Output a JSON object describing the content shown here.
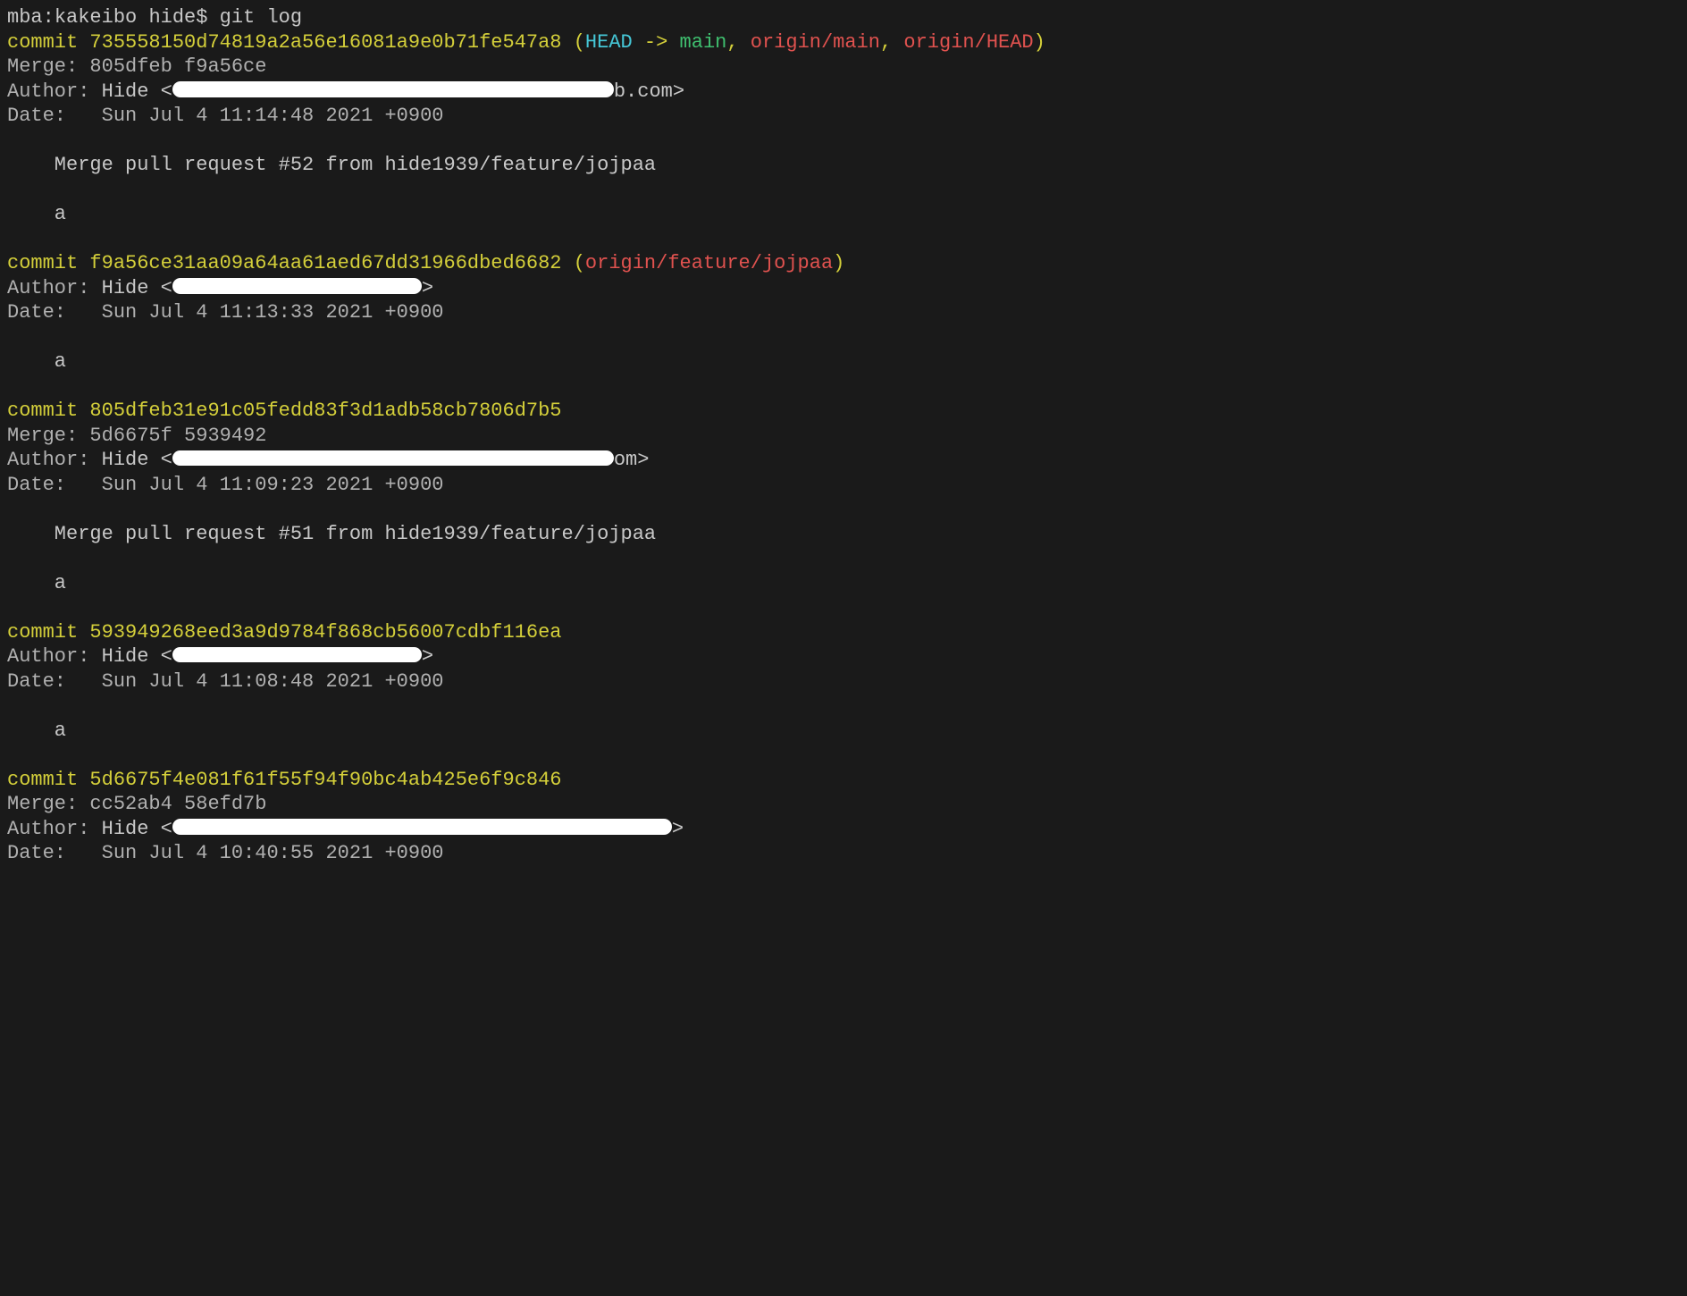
{
  "prompt": {
    "host": "mba",
    "path": "kakeibo",
    "user": "hide",
    "symbol": "$",
    "command": "git log"
  },
  "commits": [
    {
      "label": "commit",
      "hash": "735558150d74819a2a56e16081a9e0b71fe547a8",
      "refs_open": " (",
      "head": "HEAD",
      "arrow": " -> ",
      "main": "main",
      "sep1": ", ",
      "remote1": "origin/main",
      "sep2": ", ",
      "remote2": "origin/HEAD",
      "refs_close": ")",
      "merge_label": "Merge: ",
      "merge_value": "805dfeb f9a56ce",
      "author_label": "Author: ",
      "author_name": "Hide ",
      "author_open": "<",
      "author_tail": "b.com>",
      "date_label": "Date:   ",
      "date_value": "Sun Jul 4 11:14:48 2021 +0900",
      "body1": "    Merge pull request #52 from hide1939/feature/jojpaa",
      "body2": "    a"
    },
    {
      "label": "commit",
      "hash": "f9a56ce31aa09a64aa61aed67dd31966dbed6682",
      "refs_open": " (",
      "remote1": "origin/feature/jojpaa",
      "refs_close": ")",
      "author_label": "Author: ",
      "author_name": "Hide ",
      "author_open": "<",
      "author_tail": ">",
      "date_label": "Date:   ",
      "date_value": "Sun Jul 4 11:13:33 2021 +0900",
      "body1": "    a"
    },
    {
      "label": "commit",
      "hash": "805dfeb31e91c05fedd83f3d1adb58cb7806d7b5",
      "merge_label": "Merge: ",
      "merge_value": "5d6675f 5939492",
      "author_label": "Author: ",
      "author_name": "Hide ",
      "author_open": "<",
      "author_tail": "om>",
      "date_label": "Date:   ",
      "date_value": "Sun Jul 4 11:09:23 2021 +0900",
      "body1": "    Merge pull request #51 from hide1939/feature/jojpaa",
      "body2": "    a"
    },
    {
      "label": "commit",
      "hash": "593949268eed3a9d9784f868cb56007cdbf116ea",
      "author_label": "Author: ",
      "author_name": "Hide ",
      "author_open": "<",
      "author_tail": ">",
      "date_label": "Date:   ",
      "date_value": "Sun Jul 4 11:08:48 2021 +0900",
      "body1": "    a"
    },
    {
      "label": "commit",
      "hash": "5d6675f4e081f61f55f94f90bc4ab425e6f9c846",
      "merge_label": "Merge: ",
      "merge_value": "cc52ab4 58efd7b",
      "author_label": "Author: ",
      "author_name": "Hide ",
      "author_open": "<",
      "author_tail": ">",
      "date_label": "Date:   ",
      "date_value": "Sun Jul 4 10:40:55 2021 +0900"
    }
  ]
}
